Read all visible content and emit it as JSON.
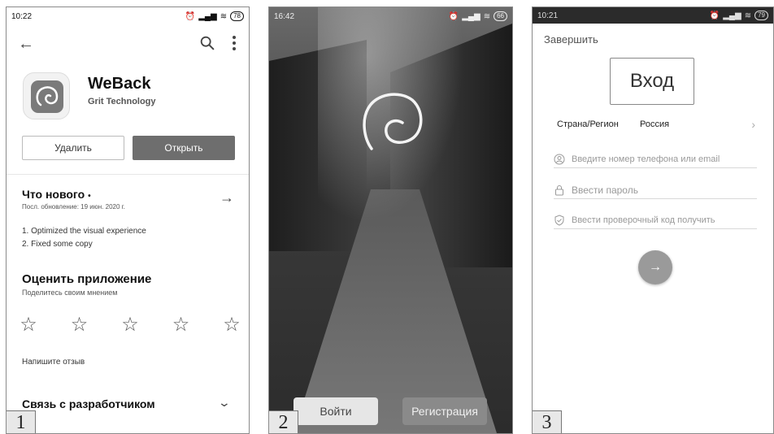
{
  "panel1": {
    "number": "1",
    "status": {
      "time": "10:22",
      "battery": "78"
    },
    "app": {
      "name": "WeBack",
      "developer": "Grit Technology"
    },
    "buttons": {
      "uninstall": "Удалить",
      "open": "Открыть"
    },
    "whats_new": {
      "title": "Что нового",
      "dot": "•",
      "updated": "Посл. обновление: 19 июн. 2020 г.",
      "notes": [
        "1. Optimized the visual experience",
        "2. Fixed some copy"
      ]
    },
    "rate": {
      "title": "Оценить приложение",
      "subtitle": "Поделитесь своим мнением",
      "stars": [
        "☆",
        "☆",
        "☆",
        "☆",
        "☆"
      ]
    },
    "write_review": "Напишите отзыв",
    "contact": "Связь с разработчиком"
  },
  "panel2": {
    "number": "2",
    "status": {
      "time": "16:42",
      "battery": "66"
    },
    "buttons": {
      "login": "Войти",
      "register": "Регистрация"
    }
  },
  "panel3": {
    "number": "3",
    "status": {
      "time": "10:21",
      "battery": "79"
    },
    "finish": "Завершить",
    "title": "Вход",
    "region": {
      "label": "Страна/Регион",
      "value": "Россия"
    },
    "fields": {
      "phone_placeholder": "Введите номер телефона или email",
      "password_placeholder": "Ввести пароль",
      "code_placeholder": "Ввести проверочный код получить"
    }
  },
  "colors": {
    "open_button": "#6e6e6e",
    "go_button": "#9a9a9a",
    "register_button": "#8a8a8a"
  }
}
